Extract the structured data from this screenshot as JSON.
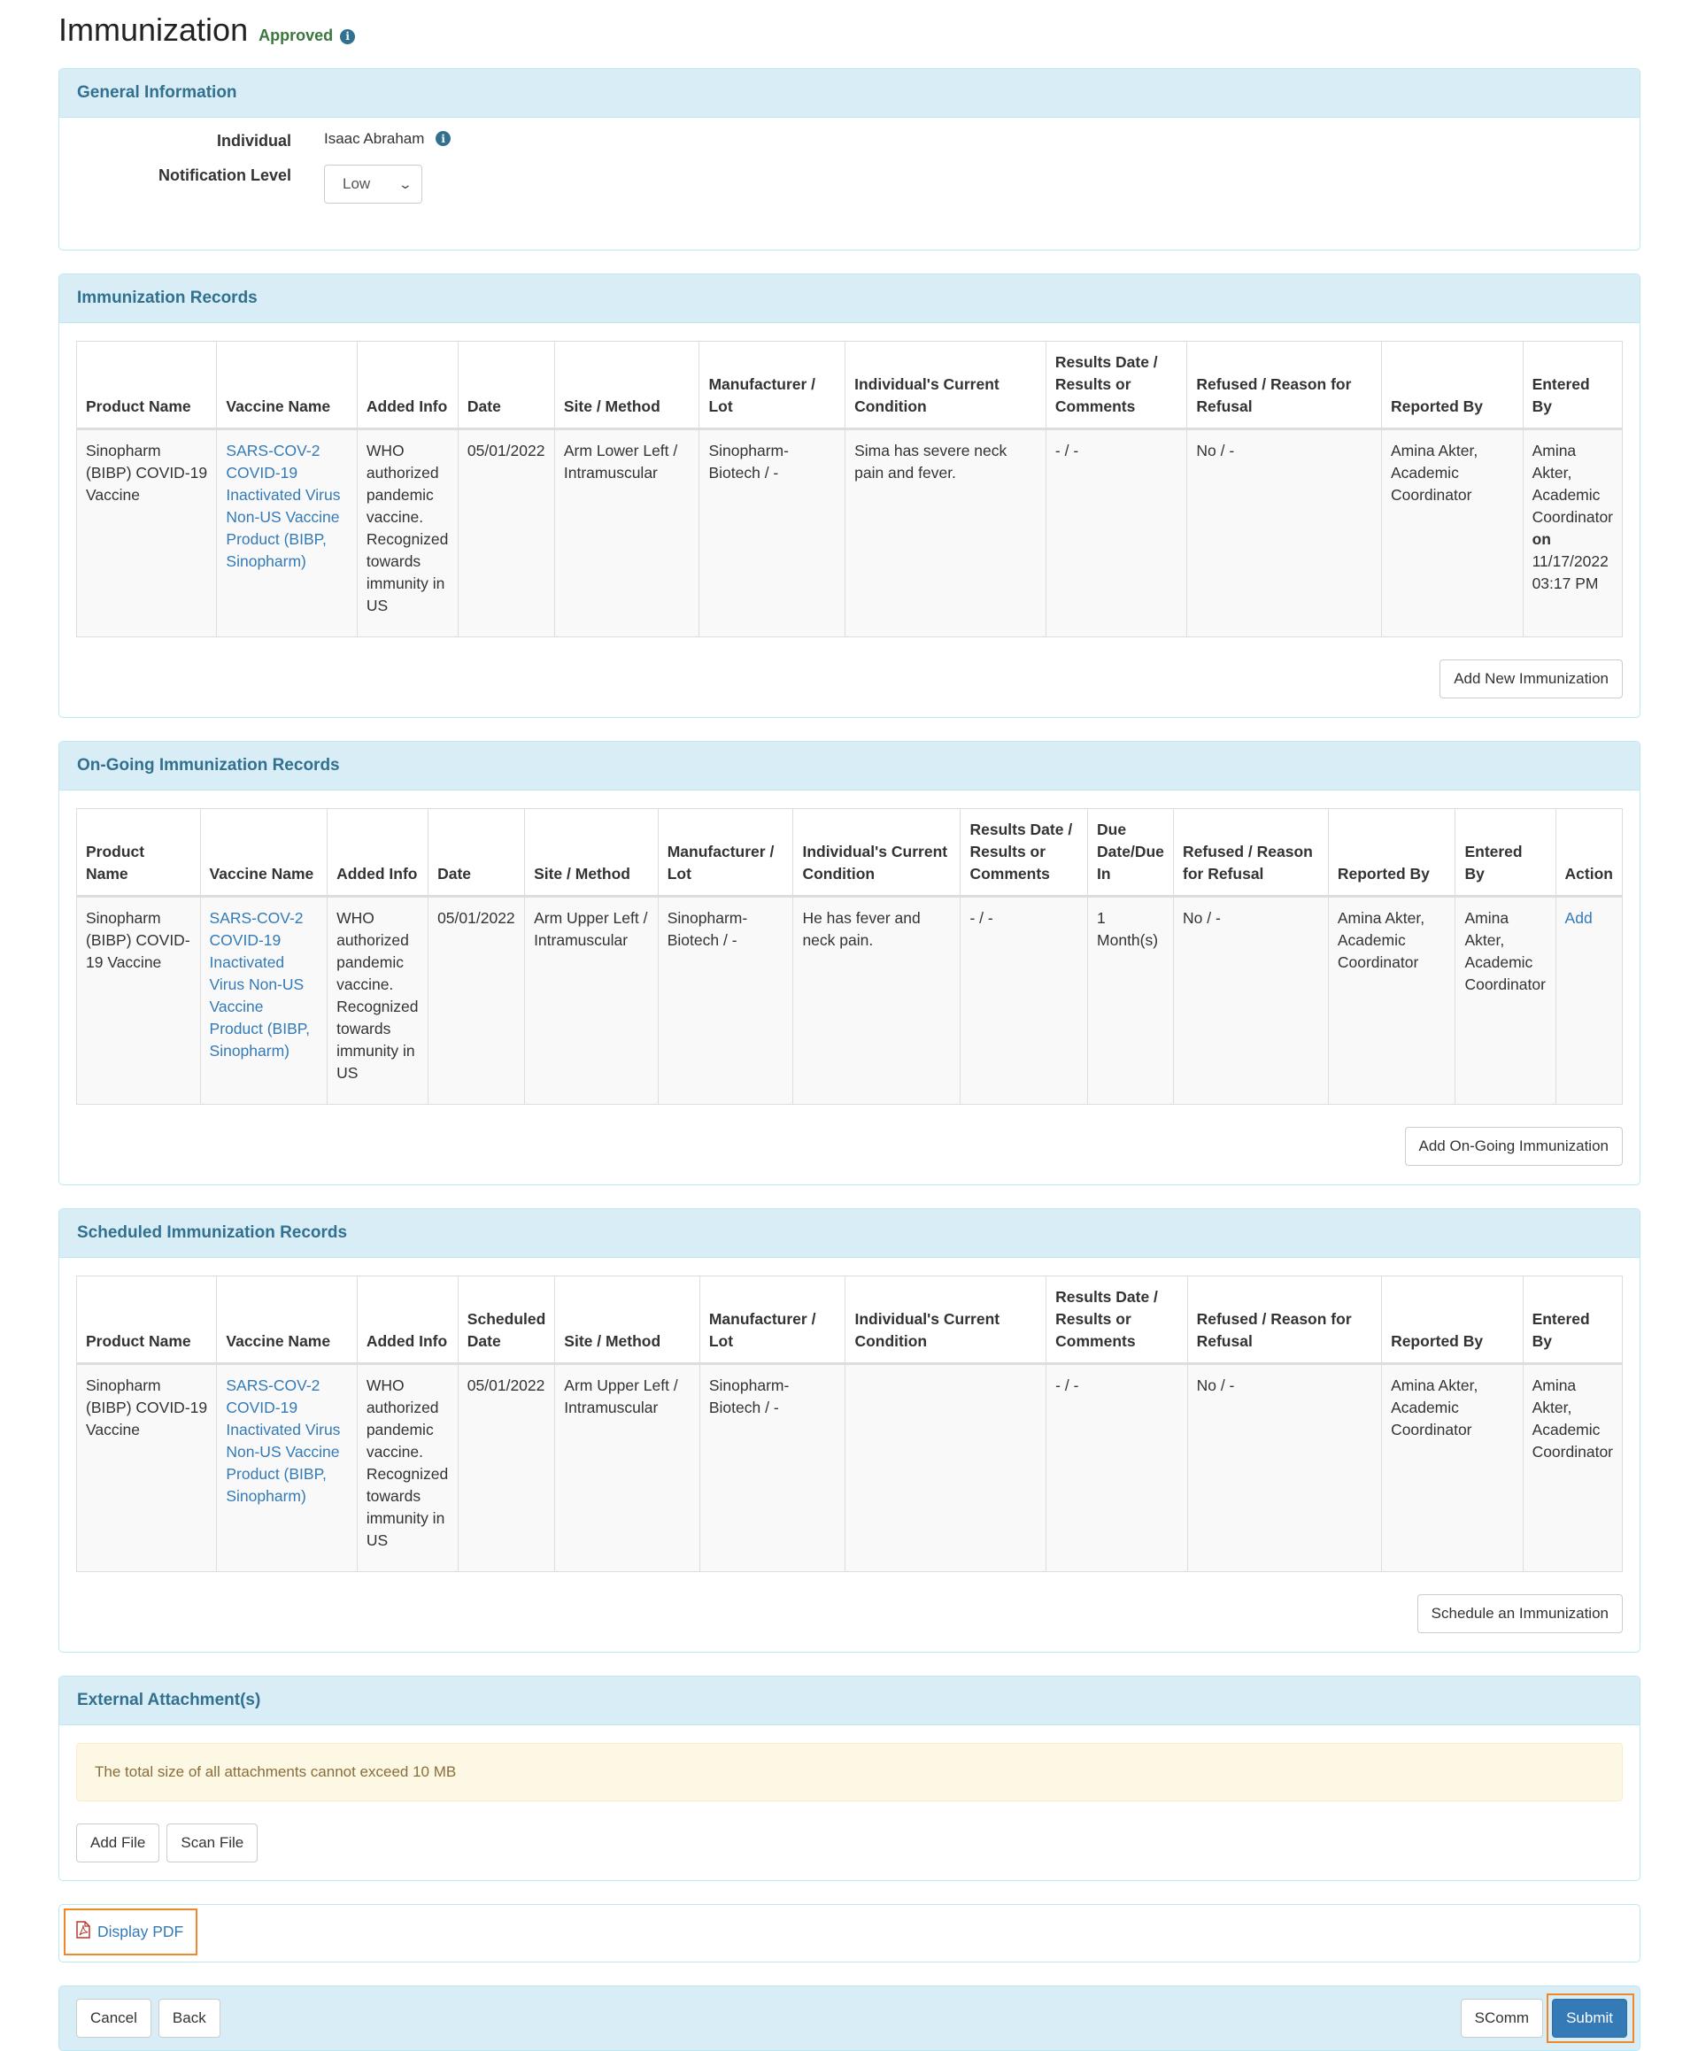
{
  "header": {
    "title": "Immunization",
    "status": "Approved",
    "status_color": "#3c763d",
    "info_icon": "info-circle-icon"
  },
  "general": {
    "heading": "General Information",
    "individual_label": "Individual",
    "individual_value": "Isaac Abraham",
    "notification_label": "Notification Level",
    "notification_value": "Low"
  },
  "records": {
    "heading": "Immunization Records",
    "columns": [
      "Product Name",
      "Vaccine Name",
      "Added Info",
      "Date",
      "Site / Method",
      "Manufacturer / Lot",
      "Individual's Current Condition",
      "Results Date / Results or Comments",
      "Refused / Reason for Refusal",
      "Reported By",
      "Entered By"
    ],
    "rows": [
      {
        "product": "Sinopharm (BIBP) COVID-19 Vaccine",
        "vaccine": "SARS-COV-2 COVID-19 Inactivated Virus Non-US Vaccine Product (BIBP, Sinopharm)",
        "added_info": "WHO authorized pandemic vaccine. Recognized towards immunity in US",
        "date": "05/01/2022",
        "site_method": "Arm Lower Left / Intramuscular",
        "manufacturer_lot": "Sinopharm-Biotech / -",
        "condition": "Sima has severe neck pain and fever.",
        "results": "- / -",
        "refused": "No / -",
        "reported_by": "Amina Akter, Academic Coordinator",
        "entered_by": "Amina Akter, Academic Coordinator",
        "entered_on_label": "on",
        "entered_on": "11/17/2022 03:17 PM"
      }
    ],
    "add_button": "Add New Immunization"
  },
  "ongoing": {
    "heading": "On-Going Immunization Records",
    "columns": [
      "Product Name",
      "Vaccine Name",
      "Added Info",
      "Date",
      "Site / Method",
      "Manufacturer / Lot",
      "Individual's Current Condition",
      "Results Date / Results or Comments",
      "Due Date/Due In",
      "Refused / Reason for Refusal",
      "Reported By",
      "Entered By",
      "Action"
    ],
    "rows": [
      {
        "product": "Sinopharm (BIBP) COVID-19 Vaccine",
        "vaccine": "SARS-COV-2 COVID-19 Inactivated Virus Non-US Vaccine Product (BIBP, Sinopharm)",
        "added_info": "WHO authorized pandemic vaccine. Recognized towards immunity in US",
        "date": "05/01/2022",
        "site_method": "Arm Upper Left / Intramuscular",
        "manufacturer_lot": "Sinopharm-Biotech / -",
        "condition": "He has fever and neck pain.",
        "results": "- / -",
        "due": "1 Month(s)",
        "refused": "No / -",
        "reported_by": "Amina Akter, Academic Coordinator",
        "entered_by": "Amina Akter, Academic Coordinator",
        "action": "Add"
      }
    ],
    "add_button": "Add On-Going Immunization"
  },
  "scheduled": {
    "heading": "Scheduled Immunization Records",
    "columns": [
      "Product Name",
      "Vaccine Name",
      "Added Info",
      "Scheduled Date",
      "Site / Method",
      "Manufacturer / Lot",
      "Individual's Current Condition",
      "Results Date / Results or Comments",
      "Refused / Reason for Refusal",
      "Reported By",
      "Entered By"
    ],
    "rows": [
      {
        "product": "Sinopharm (BIBP) COVID-19 Vaccine",
        "vaccine": "SARS-COV-2 COVID-19 Inactivated Virus Non-US Vaccine Product (BIBP, Sinopharm)",
        "added_info": "WHO authorized pandemic vaccine. Recognized towards immunity in US",
        "date": "05/01/2022",
        "site_method": "Arm Upper Left / Intramuscular",
        "manufacturer_lot": "Sinopharm-Biotech / -",
        "condition": "",
        "results": "- / -",
        "refused": "No / -",
        "reported_by": "Amina Akter, Academic Coordinator",
        "entered_by": "Amina Akter, Academic Coordinator"
      }
    ],
    "add_button": "Schedule an Immunization"
  },
  "attachments": {
    "heading": "External Attachment(s)",
    "notice": "The total size of all attachments cannot exceed 10 MB",
    "add_file": "Add File",
    "scan_file": "Scan File"
  },
  "pdf": {
    "label": "Display PDF",
    "icon": "file-pdf-icon"
  },
  "footer": {
    "cancel": "Cancel",
    "back": "Back",
    "scomm": "SComm",
    "submit": "Submit"
  }
}
